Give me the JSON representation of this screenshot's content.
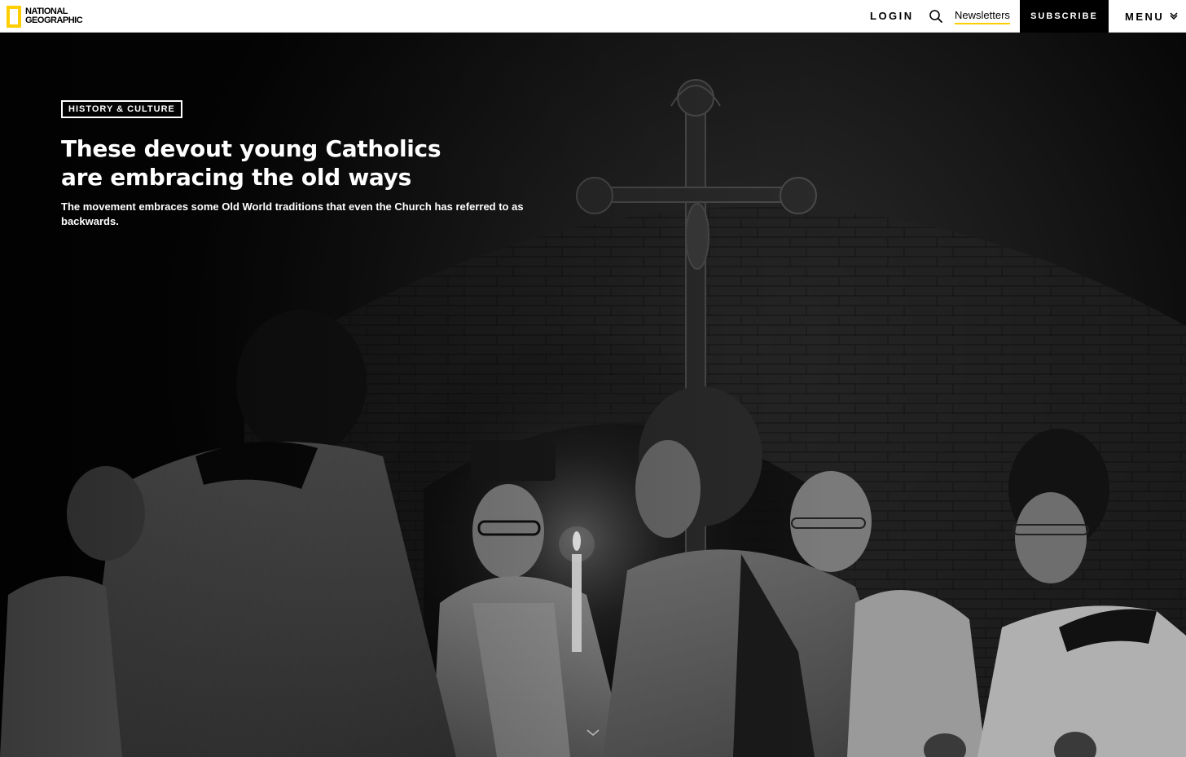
{
  "brand": {
    "logo_line1": "NATIONAL",
    "logo_line2": "GEOGRAPHIC",
    "accent_color": "#FFCE00"
  },
  "nav": {
    "login_label": "LOGIN",
    "search_icon": "search-icon",
    "newsletters_label": "Newsletters",
    "subscribe_label": "SUBSCRIBE",
    "menu_label": "MENU",
    "menu_icon": "chevron-down-icon"
  },
  "hero": {
    "category": "HISTORY & CULTURE",
    "headline": "These devout young Catholics are embracing the old ways",
    "dek": "The movement embraces some Old World traditions that even the Church has referred to as backwards.",
    "image_style": "black-and-white photograph",
    "scroll_icon": "chevron-down-icon"
  }
}
